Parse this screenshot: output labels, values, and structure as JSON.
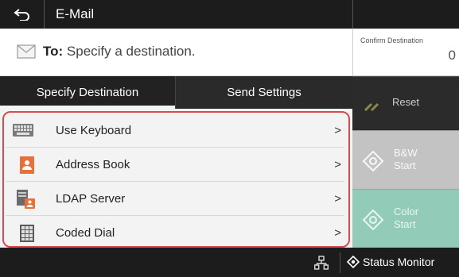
{
  "header": {
    "title": "E-Mail"
  },
  "destination": {
    "to_label": "To:",
    "to_value": "Specify a destination.",
    "confirm_label": "Confirm Destination",
    "confirm_count": "0"
  },
  "tabs": [
    {
      "label": "Specify Destination",
      "selected": true
    },
    {
      "label": "Send Settings",
      "selected": false
    }
  ],
  "menu_items": [
    {
      "label": "Use Keyboard",
      "icon": "keyboard-icon"
    },
    {
      "label": "Address Book",
      "icon": "address-book-icon"
    },
    {
      "label": "LDAP Server",
      "icon": "ldap-server-icon"
    },
    {
      "label": "Coded Dial",
      "icon": "coded-dial-icon"
    }
  ],
  "chevron": ">",
  "side_buttons": {
    "reset": "Reset",
    "bw_start": "B&W\nStart",
    "color_start": "Color\nStart"
  },
  "status_bar": {
    "status_monitor": "Status Monitor"
  },
  "colors": {
    "bar_bg": "#1c1c1c",
    "bw_start_bg": "#c3c3c3",
    "color_start_bg": "#93cbb9",
    "highlight_frame": "#d64b4b"
  }
}
